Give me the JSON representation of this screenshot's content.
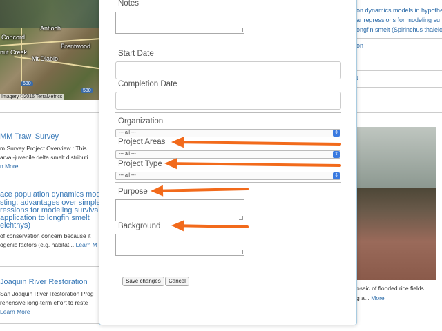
{
  "map": {
    "labels": [
      "Antioch",
      "Concord",
      "Brentwood",
      "nut Creek",
      "Mt Diablo"
    ],
    "shields": [
      "680",
      "580"
    ],
    "copyright": "Imagery ©2016 TerraMetrics"
  },
  "left_items": [
    {
      "title": "MM Trawl Survey",
      "line1": "m Survey Project Overview : This",
      "line2": "arval-juvenile delta smelt distributi",
      "more": "n More"
    },
    {
      "title_lines": [
        "ace population dynamics mode",
        "sting: advantages over simple",
        "ressions for modeling survival,",
        "application to longfin smelt",
        "eichthys)"
      ],
      "line1": "of conservation concern because it",
      "line2": "ogenic factors (e.g. habitat...",
      "more": "Learn M"
    },
    {
      "title": "Joaquin River Restoration",
      "line1": "San Joaquin River Restoration Prog",
      "line2": "rehensive long-term effort to reste",
      "more": "Learn More"
    }
  ],
  "right_items": {
    "top_lines": [
      "on dynamics models in hypothe",
      "ar regressions for modeling su",
      "ongfin smelt (Spirinchus thaleic"
    ],
    "link1": "on",
    "link2": "t",
    "caption": "osaic of flooded rice fields",
    "caption2": "g a...",
    "more": "More"
  },
  "form": {
    "notes_label": "Notes",
    "start_date_label": "Start Date",
    "completion_date_label": "Completion Date",
    "organization_label": "Organization",
    "organization_value": "--- all ---",
    "project_areas_label": "Project Areas",
    "project_areas_value": "--- all ---",
    "project_type_label": "Project Type",
    "project_type_value": "--- all ---",
    "purpose_label": "Purpose",
    "background_label": "Background",
    "save_label": "Save changes",
    "cancel_label": "Cancel",
    "arrow_color": "#f26a1b"
  }
}
